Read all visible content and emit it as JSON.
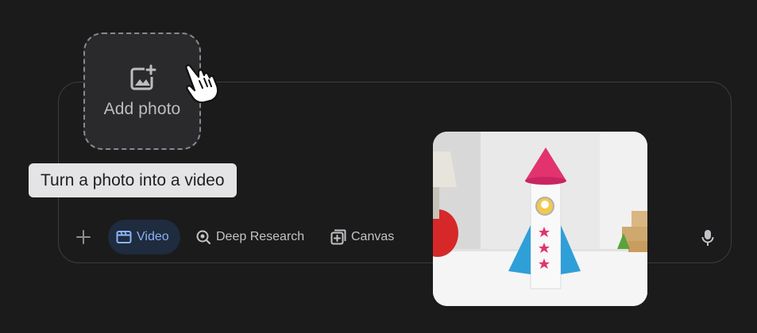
{
  "add_photo": {
    "label": "Add photo",
    "icon": "add-photo-icon"
  },
  "tooltip": {
    "text": "Turn a photo into a video"
  },
  "toolbar": {
    "plus_icon": "plus-icon",
    "tools": [
      {
        "label": "Video",
        "icon": "video-icon",
        "active": true
      },
      {
        "label": "Deep Research",
        "icon": "deep-research-icon",
        "active": false
      },
      {
        "label": "Canvas",
        "icon": "canvas-icon",
        "active": false
      }
    ],
    "mic_icon": "microphone-icon"
  },
  "photo": {
    "subject": "paper-rocket-photo"
  },
  "colors": {
    "background": "#1b1b1c",
    "border": "#3c3d41",
    "active_chip_bg": "#1f2b3e",
    "active_chip_text": "#8ab4f8",
    "tooltip_bg": "#e4e4e6"
  }
}
